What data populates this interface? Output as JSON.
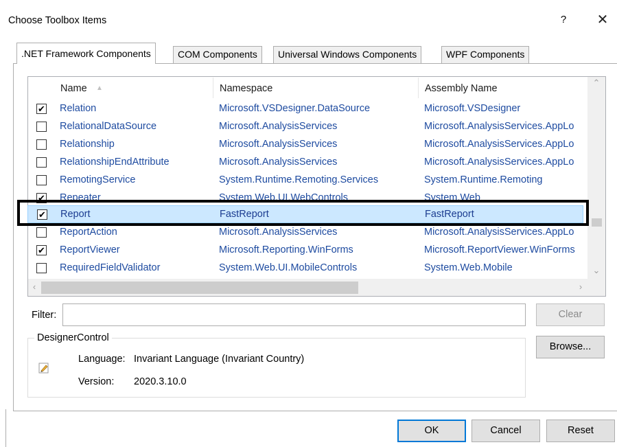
{
  "window": {
    "title": "Choose Toolbox Items",
    "help_label": "?",
    "close_label": "✕"
  },
  "tabs": [
    {
      "label": ".NET Framework Components",
      "active": true
    },
    {
      "label": "COM Components",
      "active": false
    },
    {
      "label": "Universal Windows Components",
      "active": false
    },
    {
      "label": "WPF Components",
      "active": false
    }
  ],
  "grid": {
    "columns": [
      "Name",
      "Namespace",
      "Assembly Name"
    ],
    "sort_indicator": "▲",
    "rows": [
      {
        "checked": true,
        "name": "Relation",
        "namespace": "Microsoft.VSDesigner.DataSource",
        "assembly": "Microsoft.VSDesigner"
      },
      {
        "checked": false,
        "name": "RelationalDataSource",
        "namespace": "Microsoft.AnalysisServices",
        "assembly": "Microsoft.AnalysisServices.AppLo"
      },
      {
        "checked": false,
        "name": "Relationship",
        "namespace": "Microsoft.AnalysisServices",
        "assembly": "Microsoft.AnalysisServices.AppLo"
      },
      {
        "checked": false,
        "name": "RelationshipEndAttribute",
        "namespace": "Microsoft.AnalysisServices",
        "assembly": "Microsoft.AnalysisServices.AppLo"
      },
      {
        "checked": false,
        "name": "RemotingService",
        "namespace": "System.Runtime.Remoting.Services",
        "assembly": "System.Runtime.Remoting"
      },
      {
        "checked": true,
        "name": "Repeater",
        "namespace": "System.Web.UI.WebControls",
        "assembly": "System.Web"
      },
      {
        "checked": true,
        "name": "Report",
        "namespace": "FastReport",
        "assembly": "FastReport",
        "selected": true
      },
      {
        "checked": false,
        "name": "ReportAction",
        "namespace": "Microsoft.AnalysisServices",
        "assembly": "Microsoft.AnalysisServices.AppLo"
      },
      {
        "checked": true,
        "name": "ReportViewer",
        "namespace": "Microsoft.Reporting.WinForms",
        "assembly": "Microsoft.ReportViewer.WinForms"
      },
      {
        "checked": false,
        "name": "RequiredFieldValidator",
        "namespace": "System.Web.UI.MobileControls",
        "assembly": "System.Web.Mobile"
      }
    ]
  },
  "filter": {
    "label": "Filter:",
    "value": "",
    "clear_label": "Clear"
  },
  "details": {
    "group_title": "DesignerControl",
    "language_label": "Language:",
    "language_value": "Invariant Language (Invariant Country)",
    "version_label": "Version:",
    "version_value": "2020.3.10.0",
    "browse_label": "Browse..."
  },
  "footer": {
    "ok_label": "OK",
    "cancel_label": "Cancel",
    "reset_label": "Reset"
  }
}
